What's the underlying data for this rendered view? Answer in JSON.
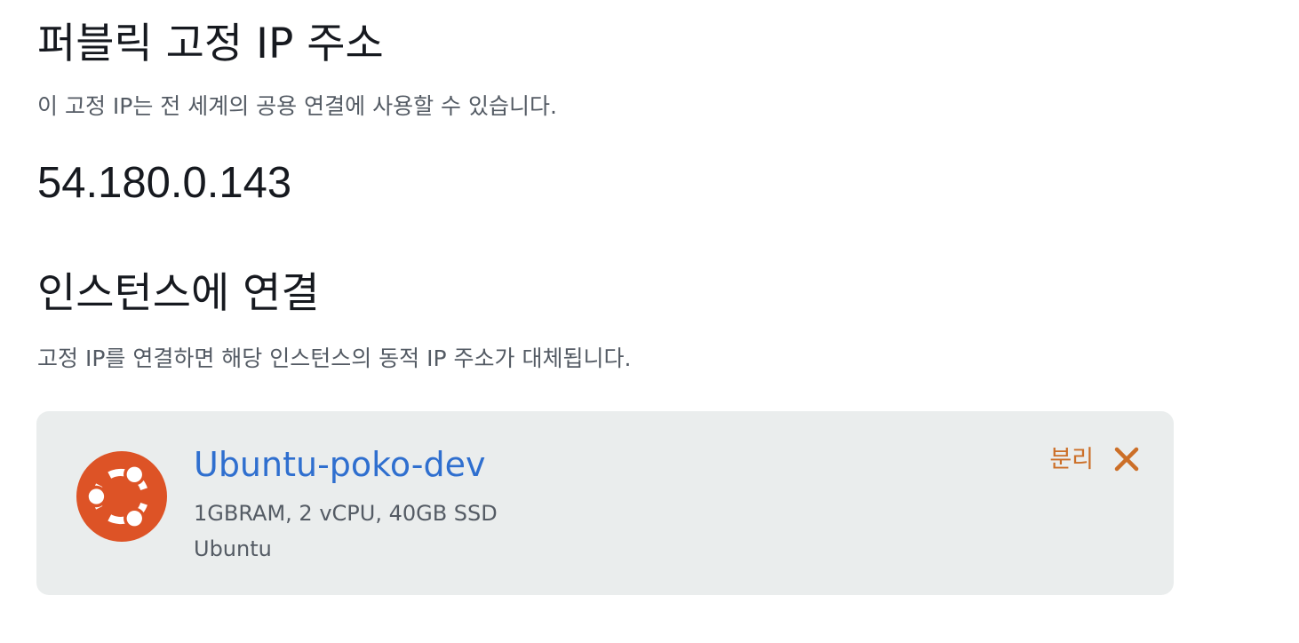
{
  "static_ip": {
    "title": "퍼블릭 고정 IP 주소",
    "description": "이 고정 IP는 전 세계의 공용 연결에 사용할 수 있습니다.",
    "address": "54.180.0.143"
  },
  "attach": {
    "title": "인스턴스에 연결",
    "description": "고정 IP를 연결하면 해당 인스턴스의 동적 IP 주소가 대체됩니다.",
    "instance": {
      "name": "Ubuntu-poko-dev",
      "specs": "1GBRAM, 2 vCPU, 40GB SSD",
      "os": "Ubuntu",
      "os_icon": "ubuntu-logo-icon",
      "detach_label": "분리",
      "detach_icon": "close-icon"
    }
  },
  "colors": {
    "link": "#2f6fcf",
    "action": "#cc6f28",
    "ubuntu": "#dd5326",
    "card_bg": "#eaeded"
  }
}
